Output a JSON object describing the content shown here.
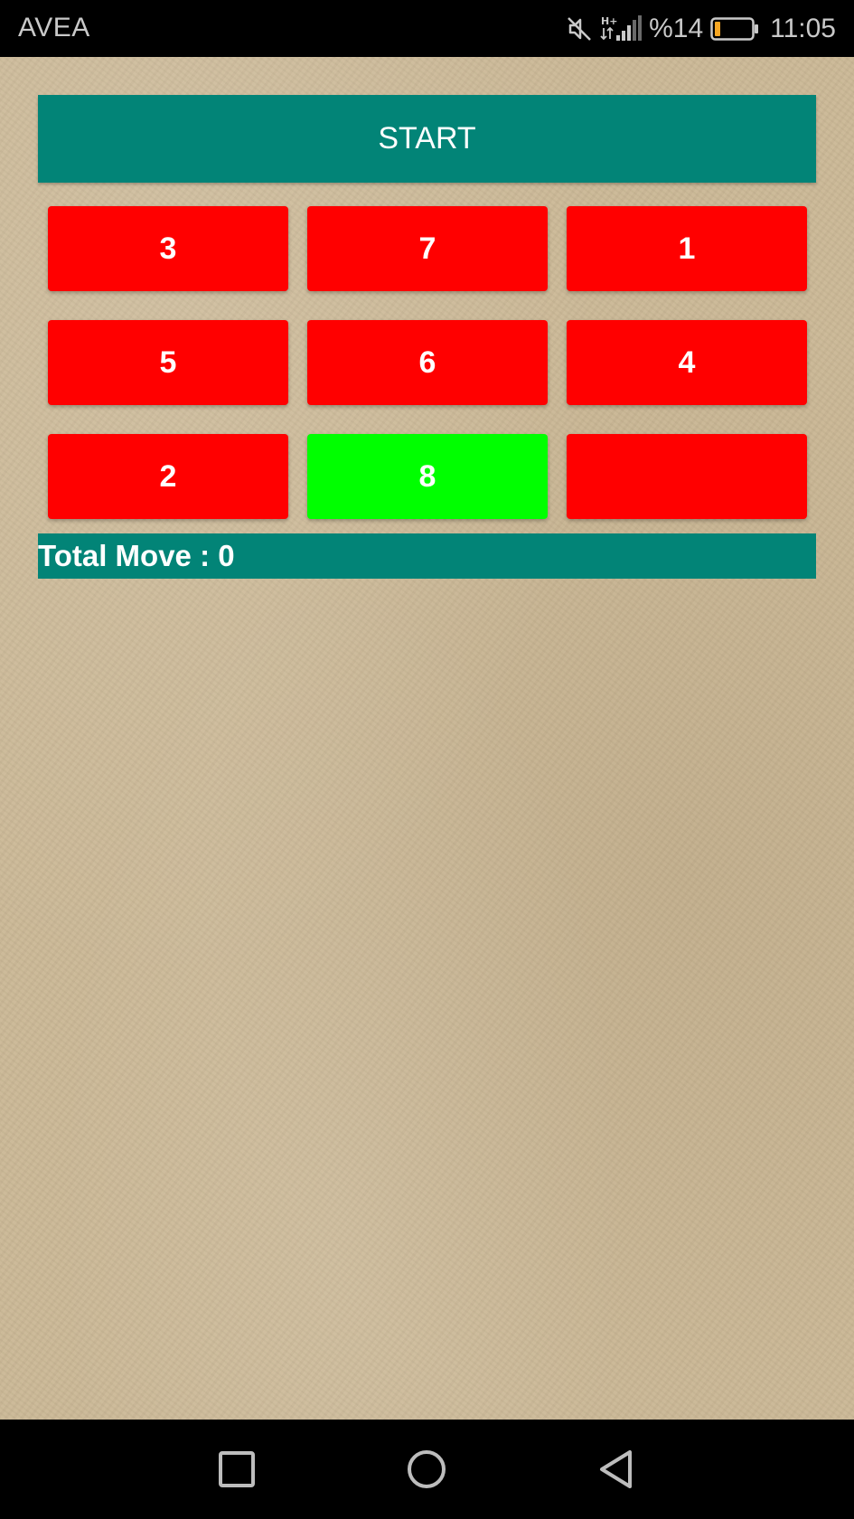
{
  "status_bar": {
    "carrier": "AVEA",
    "battery_percent": "%14",
    "battery_level": 0.14,
    "battery_color": "#f5a623",
    "time": "11:05",
    "icons": [
      "mute-icon",
      "signal-hplus-icon",
      "battery-icon"
    ]
  },
  "game": {
    "start_label": "START",
    "tiles": [
      {
        "label": "3",
        "color": "red"
      },
      {
        "label": "7",
        "color": "red"
      },
      {
        "label": "1",
        "color": "red"
      },
      {
        "label": "5",
        "color": "red"
      },
      {
        "label": "6",
        "color": "red"
      },
      {
        "label": "4",
        "color": "red"
      },
      {
        "label": "2",
        "color": "red"
      },
      {
        "label": "8",
        "color": "green"
      },
      {
        "label": "",
        "color": "red"
      }
    ],
    "move_label": "Total Move : 0"
  },
  "colors": {
    "accent_teal": "#028477",
    "tile_red": "#ff0000",
    "tile_green": "#00ff00",
    "background_paper": "#cbb896"
  },
  "nav_bar": {
    "icons": [
      "recents-square-icon",
      "home-circle-icon",
      "back-triangle-icon"
    ]
  }
}
